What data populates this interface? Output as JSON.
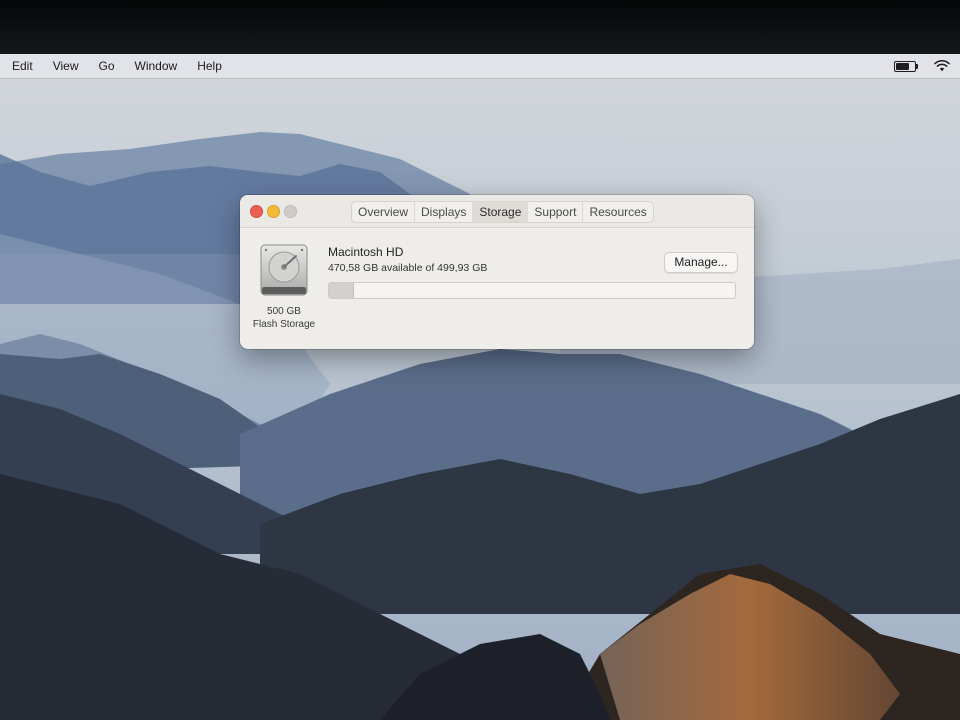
{
  "menubar": {
    "items": [
      "Edit",
      "View",
      "Go",
      "Window",
      "Help"
    ]
  },
  "status": {
    "battery_icon": "battery-icon",
    "wifi_icon": "wifi-icon",
    "battery_level": 0.8
  },
  "window": {
    "tabs": [
      {
        "label": "Overview",
        "active": false
      },
      {
        "label": "Displays",
        "active": false
      },
      {
        "label": "Storage",
        "active": true
      },
      {
        "label": "Support",
        "active": false
      },
      {
        "label": "Resources",
        "active": false
      }
    ],
    "drive": {
      "icon": "hard-drive-icon",
      "size_label": "500 GB",
      "type_label": "Flash Storage"
    },
    "volume": {
      "name": "Macintosh HD",
      "available_text": "470,58 GB available of 499,93 GB",
      "used_fraction": 0.0587
    },
    "manage_label": "Manage..."
  },
  "colors": {
    "close": "#ec5f56",
    "minimize": "#f3bb35",
    "zoom_inactive": "#cdccc9"
  }
}
